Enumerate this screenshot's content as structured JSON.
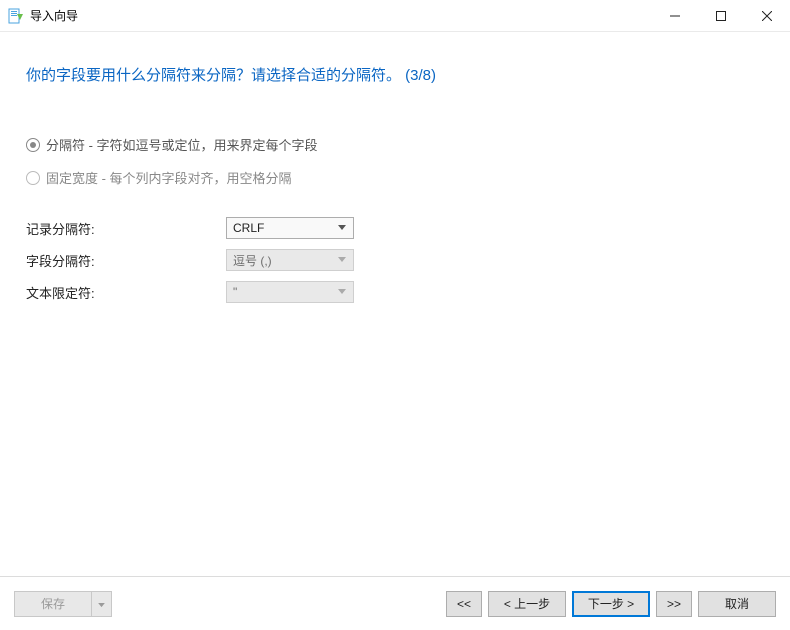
{
  "window": {
    "title": "导入向导"
  },
  "heading": "你的字段要用什么分隔符来分隔？请选择合适的分隔符。 (3/8)",
  "options": {
    "delimited": "分隔符 - 字符如逗号或定位，用来界定每个字段",
    "fixed": "固定宽度 - 每个列内字段对齐，用空格分隔"
  },
  "labels": {
    "record_sep": "记录分隔符:",
    "field_sep": "字段分隔符:",
    "text_qual": "文本限定符:"
  },
  "values": {
    "record_sep": "CRLF",
    "field_sep": "逗号 (,)",
    "text_qual": "\""
  },
  "buttons": {
    "save": "保存",
    "first": "<<",
    "back": "< 上一步",
    "next": "下一步 >",
    "last": ">>",
    "cancel": "取消"
  }
}
